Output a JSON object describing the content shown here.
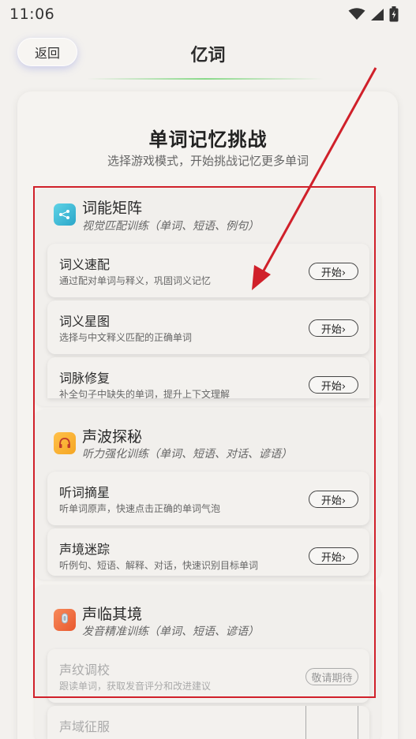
{
  "status_bar": {
    "time": "11:06"
  },
  "header": {
    "back_label": "返回",
    "title": "亿词"
  },
  "main": {
    "title": "单词记忆挑战",
    "subtitle": "选择游戏模式，开始挑战记忆更多单词"
  },
  "sections": [
    {
      "title": "词能矩阵",
      "desc": "视觉匹配训练（单词、短语、例句）",
      "icon": "matrix-icon",
      "icon_color": "#3bbfd6",
      "games": [
        {
          "name": "词义速配",
          "desc": "通过配对单词与释义，巩固词义记忆",
          "button": "开始›"
        },
        {
          "name": "词义星图",
          "desc": "选择与中文释义匹配的正确单词",
          "button": "开始›"
        },
        {
          "name": "词脉修复",
          "desc": "补全句子中缺失的单词，提升上下文理解",
          "button": "开始›"
        }
      ]
    },
    {
      "title": "声波探秘",
      "desc": "听力强化训练（单词、短语、对话、谚语）",
      "icon": "headphones-icon",
      "icon_color": "#f5a623",
      "games": [
        {
          "name": "听词摘星",
          "desc": "听单词原声，快速点击正确的单词气泡",
          "button": "开始›"
        },
        {
          "name": "声境迷踪",
          "desc": "听例句、短语、解释、对话，快速识别目标单词",
          "button": "开始›"
        }
      ]
    },
    {
      "title": "声临其境",
      "desc": "发音精准训练（单词、短语、谚语）",
      "icon": "microphone-icon",
      "icon_color": "#f06a3a",
      "games": [
        {
          "name": "声纹调校",
          "desc": "跟读单词，获取发音评分和改进建议",
          "button": "敬请期待"
        },
        {
          "name": "声域征服"
        }
      ]
    }
  ],
  "colors": {
    "annotation_red": "#d0202a",
    "accent_green": "#8ad98a"
  }
}
